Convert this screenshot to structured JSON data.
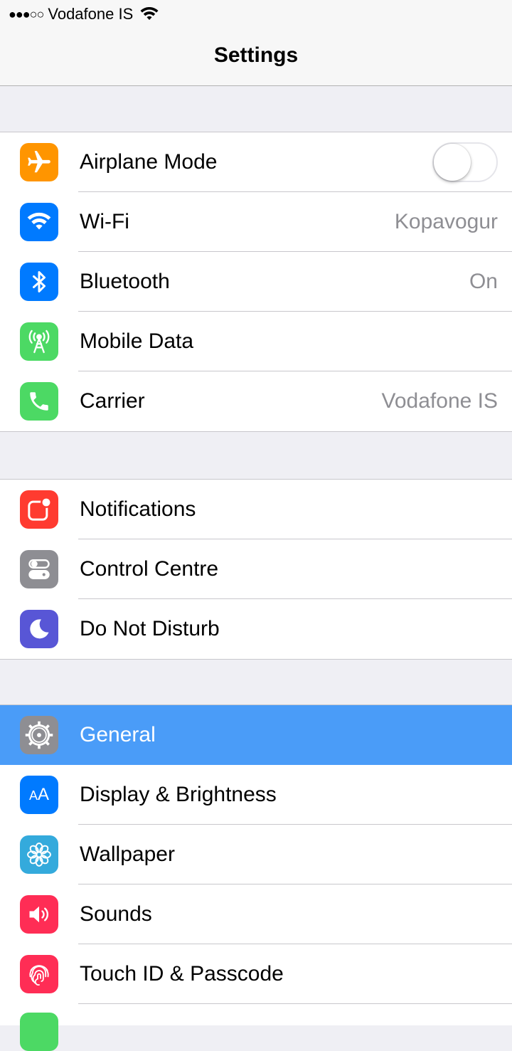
{
  "status_bar": {
    "signal": "●●●○○",
    "carrier": "Vodafone IS",
    "wifi_icon": "wifi-icon"
  },
  "nav": {
    "title": "Settings"
  },
  "colors": {
    "orange": "#ff9500",
    "blue": "#007aff",
    "green": "#4cd964",
    "red": "#ff3b30",
    "gray": "#8e8e93",
    "purple": "#5856d6",
    "selected": "#4a9cf8",
    "teal": "#34aadc",
    "pink": "#ff2d55"
  },
  "groups": [
    {
      "items": [
        {
          "label": "Airplane Mode",
          "icon": "airplane-icon",
          "toggle": false
        },
        {
          "label": "Wi-Fi",
          "icon": "wifi-icon",
          "value": "Kopavogur"
        },
        {
          "label": "Bluetooth",
          "icon": "bluetooth-icon",
          "value": "On"
        },
        {
          "label": "Mobile Data",
          "icon": "antenna-icon"
        },
        {
          "label": "Carrier",
          "icon": "phone-icon",
          "value": "Vodafone IS"
        }
      ]
    },
    {
      "items": [
        {
          "label": "Notifications",
          "icon": "notifications-icon"
        },
        {
          "label": "Control Centre",
          "icon": "control-centre-icon"
        },
        {
          "label": "Do Not Disturb",
          "icon": "moon-icon"
        }
      ]
    },
    {
      "items": [
        {
          "label": "General",
          "icon": "gear-icon",
          "selected": true
        },
        {
          "label": "Display & Brightness",
          "icon": "text-size-icon",
          "icon_text": "AA"
        },
        {
          "label": "Wallpaper",
          "icon": "flower-icon"
        },
        {
          "label": "Sounds",
          "icon": "speaker-icon"
        },
        {
          "label": "Touch ID & Passcode",
          "icon": "fingerprint-icon"
        }
      ]
    }
  ]
}
